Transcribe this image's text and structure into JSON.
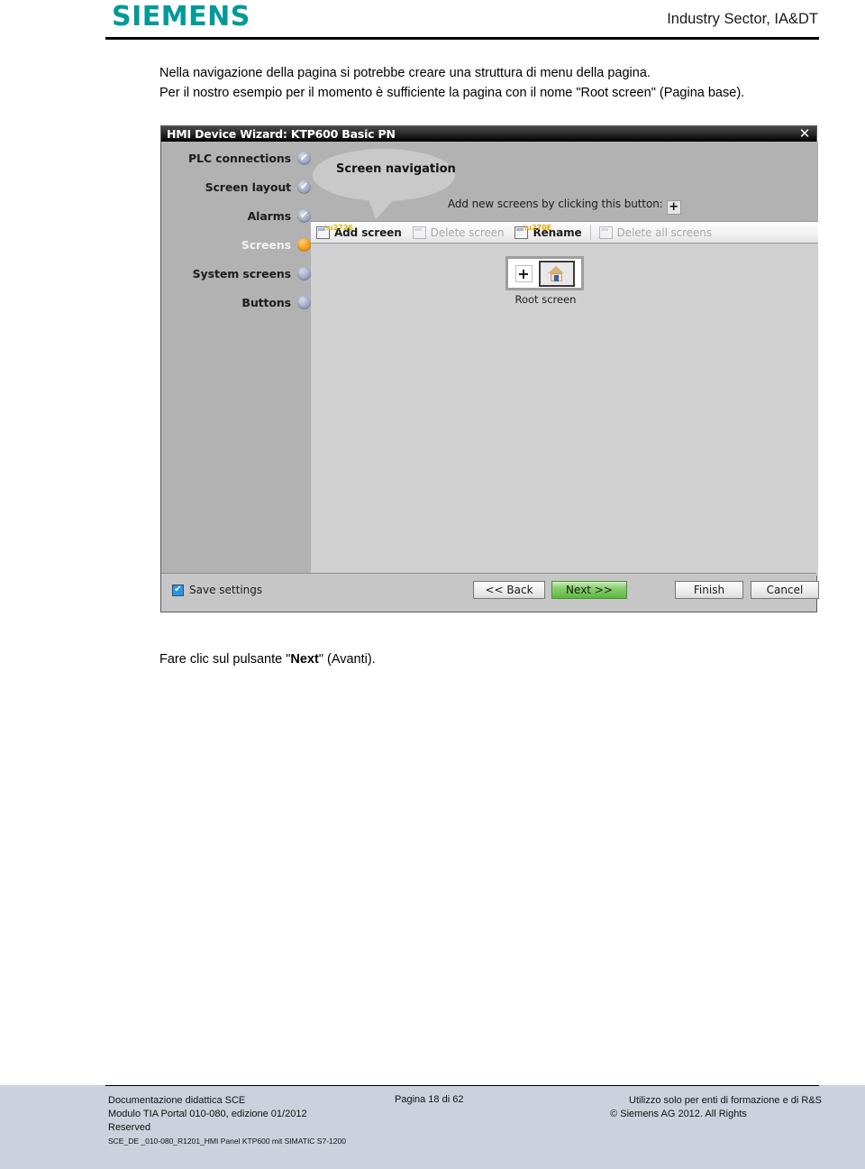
{
  "header": {
    "logo_text": "SIEMENS",
    "right_text": "Industry Sector, IA&DT",
    "logo_color": "#009999"
  },
  "intro": {
    "line1": "Nella navigazione della pagina si potrebbe creare una struttura di menu della pagina.",
    "line2": "Per il nostro esempio per il momento è sufficiente la pagina con il nome \"Root screen\" (Pagina base)."
  },
  "dialog": {
    "title": "HMI Device Wizard: KTP600 Basic PN",
    "close_icon": "close-icon",
    "close_glyph": "✕",
    "bubble_label": "Screen navigation",
    "hint_text": "Add new screens by clicking this button:",
    "hint_plus": "+",
    "sidebar": {
      "items": [
        {
          "label": "PLC connections",
          "state": "done",
          "glyph": "✔"
        },
        {
          "label": "Screen layout",
          "state": "done",
          "glyph": "✔"
        },
        {
          "label": "Alarms",
          "state": "done",
          "glyph": "✔"
        },
        {
          "label": "Screens",
          "state": "current",
          "glyph": ""
        },
        {
          "label": "System screens",
          "state": "pending",
          "glyph": ""
        },
        {
          "label": "Buttons",
          "state": "pending",
          "glyph": ""
        }
      ]
    },
    "toolbar": {
      "add_screen": "Add screen",
      "delete_screen": "Delete screen",
      "rename": "Rename",
      "delete_all_screens": "Delete all screens"
    },
    "canvas": {
      "tile_plus": "+",
      "tile_icon": "home-icon",
      "tile_caption": "Root screen"
    },
    "footer": {
      "save_settings_label": "Save settings",
      "save_settings_checked": true,
      "back_label": "<< Back",
      "back_mnemonic": "B",
      "next_label": "Next >>",
      "next_mnemonic": "N",
      "finish_label": "Finish",
      "finish_mnemonic": "F",
      "cancel_label": "Cancel",
      "cancel_mnemonic": "C",
      "next_highlight_color": "#5bb93f"
    }
  },
  "caption_below": {
    "prefix": "Fare clic sul pulsante \"",
    "bold": "Next",
    "suffix": "\" (Avanti)."
  },
  "page_footer": {
    "left_line1": "Documentazione didattica SCE",
    "left_line2": "Modulo TIA Portal 010-080, edizione 01/2012",
    "left_line3": "Reserved",
    "code": "SCE_DE _010-080_R1201_HMI Panel KTP600 mit SIMATIC S7-1200",
    "middle": "Pagina 18 di  62",
    "right_line1": "Utilizzo solo per enti di formazione e di R&S",
    "right_line2": "© Siemens AG 2012. All Rights"
  }
}
